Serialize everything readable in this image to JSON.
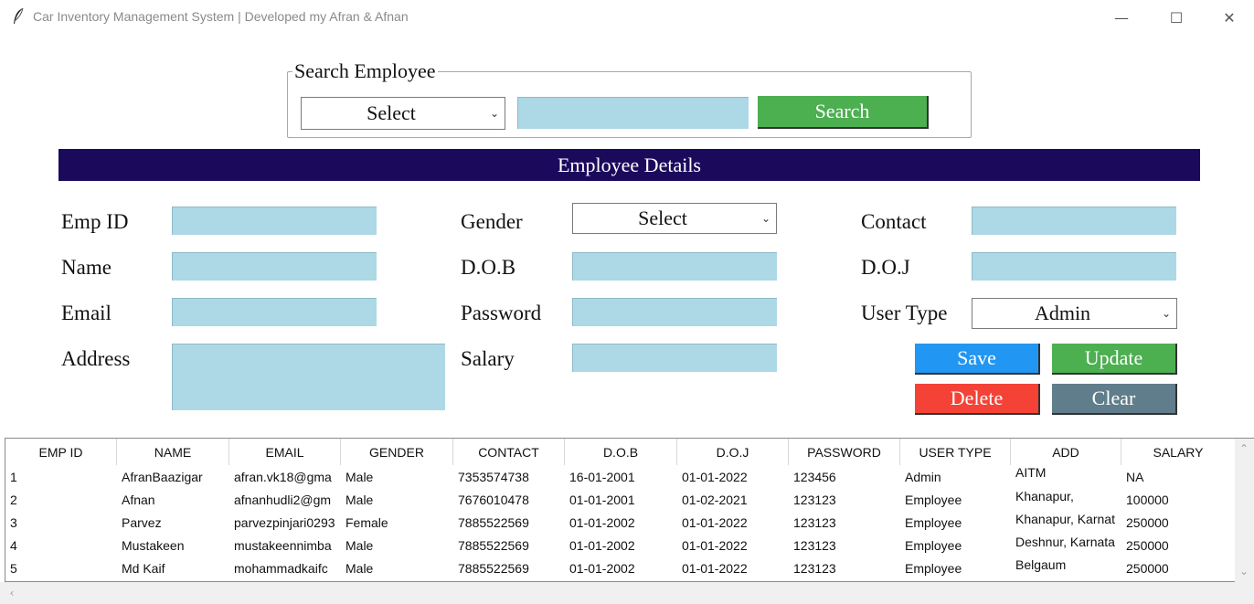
{
  "window": {
    "title": "Car Inventory Management System | Developed my Afran & Afnan",
    "minimize_glyph": "—",
    "maximize_glyph": "☐",
    "close_glyph": "✕"
  },
  "search": {
    "legend": "Search Employee",
    "select_value": "Select",
    "input_value": "",
    "button_label": "Search"
  },
  "details": {
    "header": "Employee Details",
    "labels": {
      "emp_id": "Emp ID",
      "name": "Name",
      "email": "Email",
      "address": "Address",
      "gender": "Gender",
      "dob": "D.O.B",
      "password": "Password",
      "salary": "Salary",
      "contact": "Contact",
      "doj": "D.O.J",
      "user_type": "User Type"
    },
    "gender_value": "Select",
    "user_type_value": "Admin"
  },
  "buttons": {
    "save": "Save",
    "update": "Update",
    "delete": "Delete",
    "clear": "Clear"
  },
  "table": {
    "columns": [
      "EMP ID",
      "NAME",
      "EMAIL",
      "GENDER",
      "CONTACT",
      "D.O.B",
      "D.O.J",
      "PASSWORD",
      "USER TYPE",
      "ADD",
      "SALARY"
    ],
    "rows": [
      [
        "1",
        "AfranBaazigar",
        "afran.vk18@gma",
        "Male",
        "7353574738",
        "16-01-2001",
        "01-01-2022",
        "123456",
        "Admin",
        "AITM",
        "NA"
      ],
      [
        "2",
        "Afnan",
        "afnanhudli2@gm",
        "Male",
        "7676010478",
        "01-01-2001",
        "01-02-2021",
        "123123",
        "Employee",
        "Khanapur,",
        "100000"
      ],
      [
        "3",
        "Parvez",
        "parvezpinjari0293",
        "Female",
        "7885522569",
        "01-01-2002",
        "01-01-2022",
        "123123",
        "Employee",
        "Khanapur, Karnat",
        "250000"
      ],
      [
        "4",
        "Mustakeen",
        "mustakeennimba",
        "Male",
        "7885522569",
        "01-01-2002",
        "01-01-2022",
        "123123",
        "Employee",
        "Deshnur, Karnata",
        "250000"
      ],
      [
        "5",
        "Md Kaif",
        "mohammadkaifc",
        "Male",
        "7885522569",
        "01-01-2002",
        "01-01-2022",
        "123123",
        "Employee",
        "Belgaum",
        "250000"
      ]
    ]
  },
  "colors": {
    "entry_bg": "#add8e6",
    "header_band": "#1b0a5c",
    "search_button": "#4caf50",
    "save_button": "#2196f3",
    "update_button": "#4caf50",
    "delete_button": "#f44336",
    "clear_button": "#607d8b"
  },
  "icons": {
    "app": "feather-icon",
    "scroll_up": "chevron-up-icon",
    "scroll_down": "chevron-down-icon",
    "scroll_left": "chevron-left-icon"
  }
}
